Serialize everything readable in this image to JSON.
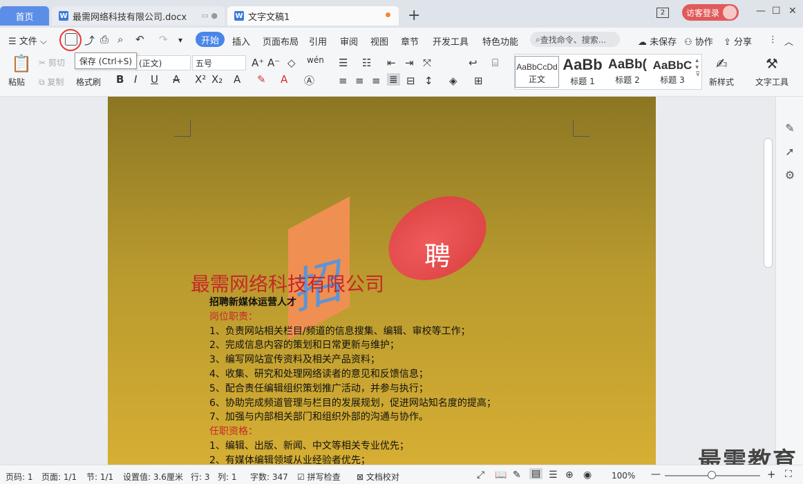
{
  "tabs": {
    "home": "首页",
    "doc1": "最需网络科技有限公司.docx",
    "doc2": "文字文稿1",
    "new_tab": "+",
    "badge": "2",
    "login": "访客登录"
  },
  "menu": {
    "file": "文件",
    "items": [
      "开始",
      "插入",
      "页面布局",
      "引用",
      "审阅",
      "视图",
      "章节",
      "开发工具",
      "特色功能"
    ],
    "search_placeholder": "查找命令、搜索...",
    "unsaved": "未保存",
    "collab": "协作",
    "share": "分享"
  },
  "tooltip": "保存 (Ctrl+S)",
  "ribbon": {
    "paste": "粘贴",
    "cut": "剪切",
    "copy": "复制",
    "format_painter": "格式刷",
    "font_name": "(正文)",
    "font_size": "五号",
    "styles": [
      {
        "sample": "AaBbCcDd",
        "name": "正文"
      },
      {
        "sample": "AaBb",
        "name": "标题 1"
      },
      {
        "sample": "AaBb(",
        "name": "标题 2"
      },
      {
        "sample": "AaBbC",
        "name": "标题 3"
      }
    ],
    "new_style": "新样式",
    "text_tools": "文字工具"
  },
  "document": {
    "shape_left": "招",
    "shape_right": "聘",
    "company": "最需网络科技有限公司",
    "lines": [
      {
        "text": "招聘新媒体运营人才",
        "style": "bold"
      },
      {
        "text": "岗位职责：",
        "style": "red"
      },
      {
        "text": "1、负责网站相关栏目/频道的信息搜集、编辑、审校等工作；",
        "style": ""
      },
      {
        "text": "2、完成信息内容的策划和日常更新与维护；",
        "style": ""
      },
      {
        "text": "3、编写网站宣传资料及相关产品资料；",
        "style": ""
      },
      {
        "text": "4、收集、研究和处理网络读者的意见和反馈信息；",
        "style": ""
      },
      {
        "text": "5、配合责任编辑组织策划推广活动，并参与执行；",
        "style": ""
      },
      {
        "text": "6、协助完成频道管理与栏目的发展规划，促进网站知名度的提高；",
        "style": ""
      },
      {
        "text": "7、加强与内部相关部门和组织外部的沟通与协作。",
        "style": ""
      },
      {
        "text": "任职资格：",
        "style": "red"
      },
      {
        "text": "1、编辑、出版、新闻、中文等相关专业优先；",
        "style": ""
      },
      {
        "text": "2、有媒体编辑领域从业经验者优先；",
        "style": ""
      }
    ]
  },
  "watermark": "最需教育",
  "status": {
    "page_no": "页码: 1",
    "pages": "页面: 1/1",
    "section": "节: 1/1",
    "setting": "设置值: 3.6厘米",
    "row": "行: 3",
    "col": "列: 1",
    "words": "字数: 347",
    "spell": "拼写检查",
    "proof": "文档校对",
    "zoom": "100%"
  },
  "colors": {
    "accent": "#4a86e8",
    "login": "#e15a5a",
    "company_red": "#c62828"
  }
}
